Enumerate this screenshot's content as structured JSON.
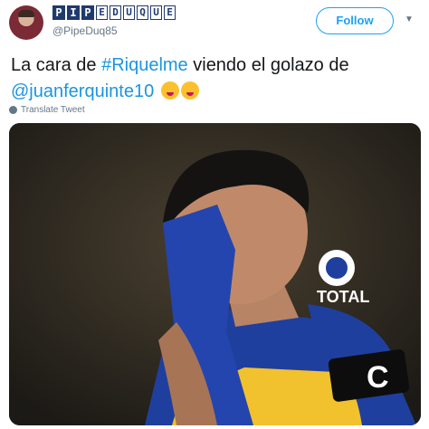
{
  "user": {
    "name_letters": [
      "P",
      "I",
      "P",
      "E",
      "D",
      "U",
      "Q",
      "U",
      "E"
    ],
    "handle": "@PipeDuq85"
  },
  "follow_label": "Follow",
  "tweet": {
    "text_part1": "La cara de ",
    "hashtag": "#Riquelme",
    "text_part2": " viendo el golazo de",
    "mention": "@juanferquinte10"
  },
  "translate_label": "Translate Tweet",
  "photo": {
    "sponsor": "TOTAL",
    "armband_letter": "C"
  },
  "colors": {
    "link": "#1b95e0",
    "follow": "#1da1f2",
    "jersey_blue": "#1f3f9e",
    "jersey_yellow": "#f2c12e"
  }
}
